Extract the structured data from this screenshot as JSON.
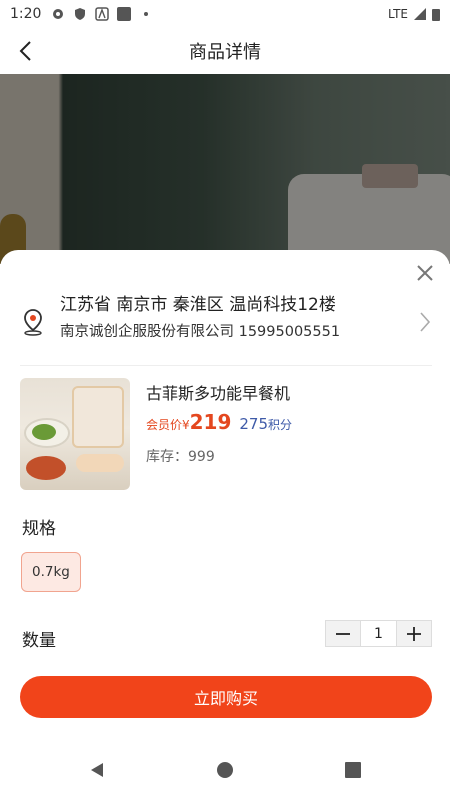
{
  "status_bar": {
    "time": "1:20",
    "network": "LTE"
  },
  "nav": {
    "title": "商品详情"
  },
  "address": {
    "line1": "江苏省 南京市 秦淮区 温尚科技12楼",
    "line2": "南京诚创企服股份有限公司 15995005551"
  },
  "product": {
    "name": "古菲斯多功能早餐机",
    "price_label": "会员价¥",
    "price": "219",
    "points": "275",
    "points_unit": "积分",
    "stock": "库存：999"
  },
  "spec": {
    "title": "规格",
    "options": [
      "0.7kg"
    ],
    "selected": "0.7kg"
  },
  "quantity": {
    "label": "数量",
    "value": "1",
    "minus": "−",
    "plus": "+"
  },
  "buy_button": "立即购买",
  "colors": {
    "accent": "#f1441a",
    "price": "#e4471f",
    "points": "#3e5aa8"
  }
}
